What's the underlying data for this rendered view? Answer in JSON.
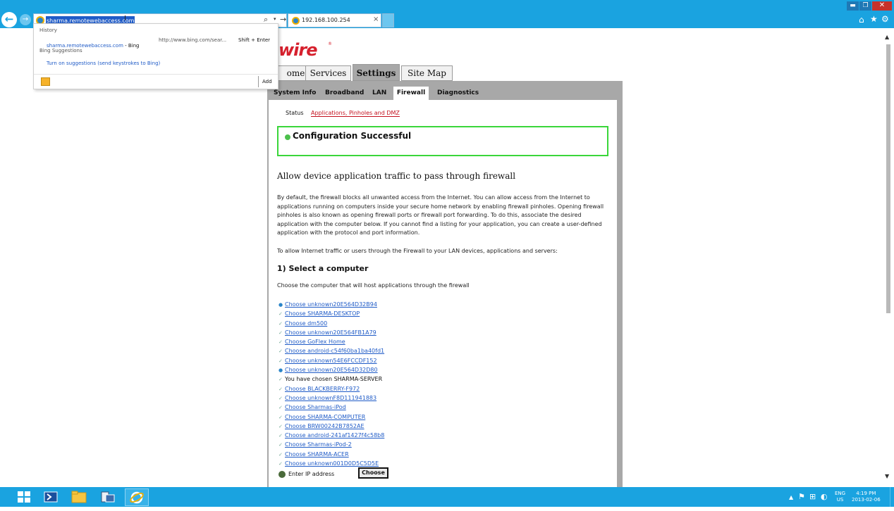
{
  "browser": {
    "address_value": "sharma.remotewebaccess.com",
    "tab_title": "192.168.100.254",
    "tab_close": "×",
    "nav": {
      "back": "←",
      "forward": "→",
      "search": "⌕",
      "dropdown": "▾",
      "go": "→"
    },
    "window": {
      "minimize": "▬",
      "restore": "❐",
      "close": "✕"
    },
    "toolbar": {
      "home": "⌂",
      "favorites": "★",
      "tools": "⚙"
    },
    "accent_color": "#1aa3e0"
  },
  "suggestions": {
    "history_label": "History",
    "history_item": "sharma.remotewebaccess.com",
    "history_suffix": " - Bing",
    "history_url": "http://www.bing.com/sear...",
    "history_shortcut": "Shift + Enter",
    "bing_label": "Bing Suggestions",
    "turn_on": "Turn on suggestions (send keystrokes to Bing)",
    "add_label": "Add"
  },
  "page": {
    "logo": "wire",
    "logo_mark": "®",
    "main_tabs": [
      "ome",
      "Services",
      "Settings",
      "Site Map"
    ],
    "sub_tabs": [
      "System Info",
      "Broadband",
      "LAN",
      "Firewall",
      "Diagnostics"
    ],
    "status_link": "Status",
    "apps_link": "Applications, Pinholes and DMZ",
    "success": "Configuration Successful",
    "section_title": "Allow device application traffic to pass through firewall",
    "para1": "By default, the firewall blocks all unwanted access from the Internet. You can allow access from the Internet to applications running on computers inside your secure home network by enabling firewall pinholes. Opening firewall pinholes is also known as opening firewall ports or firewall port forwarding. To do this, associate the desired application with the computer below. If you cannot find a listing for your application, you can create a user-defined application with the protocol and port information.",
    "para2": "To allow Internet traffic or users through the Firewall to your LAN devices, applications and servers:",
    "step_title": "1) Select a computer",
    "step_desc": "Choose the computer that will host applications through the firewall",
    "computers": [
      {
        "text": "Choose unknown20E564D32B94",
        "link": true,
        "selected_icon": true
      },
      {
        "text": "Choose SHARMA-DESKTOP",
        "link": true,
        "selected_icon": false
      },
      {
        "text": "Choose dm500",
        "link": true,
        "selected_icon": false
      },
      {
        "text": "Choose unknown20E564FB1A79",
        "link": true,
        "selected_icon": false
      },
      {
        "text": "Choose GoFlex Home",
        "link": true,
        "selected_icon": false
      },
      {
        "text": "Choose android-c54f60ba1ba40fd1",
        "link": true,
        "selected_icon": false
      },
      {
        "text": "Choose unknown54E6FCCDF152",
        "link": true,
        "selected_icon": false
      },
      {
        "text": "Choose unknown20E564D32D80",
        "link": true,
        "selected_icon": true
      },
      {
        "text": "You have chosen SHARMA-SERVER",
        "link": false,
        "selected_icon": false
      },
      {
        "text": "Choose BLACKBERRY-F972",
        "link": true,
        "selected_icon": false
      },
      {
        "text": "Choose unknownF8D111941883",
        "link": true,
        "selected_icon": false
      },
      {
        "text": "Choose Sharmas-iPod",
        "link": true,
        "selected_icon": false
      },
      {
        "text": "Choose SHARMA-COMPUTER",
        "link": true,
        "selected_icon": false
      },
      {
        "text": "Choose BRW00242B7852AE",
        "link": true,
        "selected_icon": false
      },
      {
        "text": "Choose android-241af1427f4c58b8",
        "link": true,
        "selected_icon": false
      },
      {
        "text": "Choose Sharmas-iPod-2",
        "link": true,
        "selected_icon": false
      },
      {
        "text": "Choose SHARMA-ACER",
        "link": true,
        "selected_icon": false
      },
      {
        "text": "Choose unknown001D0D5C5D5E",
        "link": true,
        "selected_icon": false
      }
    ],
    "ip_placeholder": "Enter IP address",
    "choose_button": "Choose",
    "success_color": "#3ad63a",
    "brand_color": "#d6202d"
  },
  "scrollbar": {
    "up": "▲",
    "down": "▼"
  },
  "taskbar": {
    "apps": [
      "start",
      "powershell",
      "file-explorer",
      "server-manager",
      "internet-explorer"
    ],
    "tray_arrow": "▲",
    "lang_line1": "ENG",
    "lang_line2": "US",
    "time": "4:19 PM",
    "date": "2013-02-06"
  }
}
